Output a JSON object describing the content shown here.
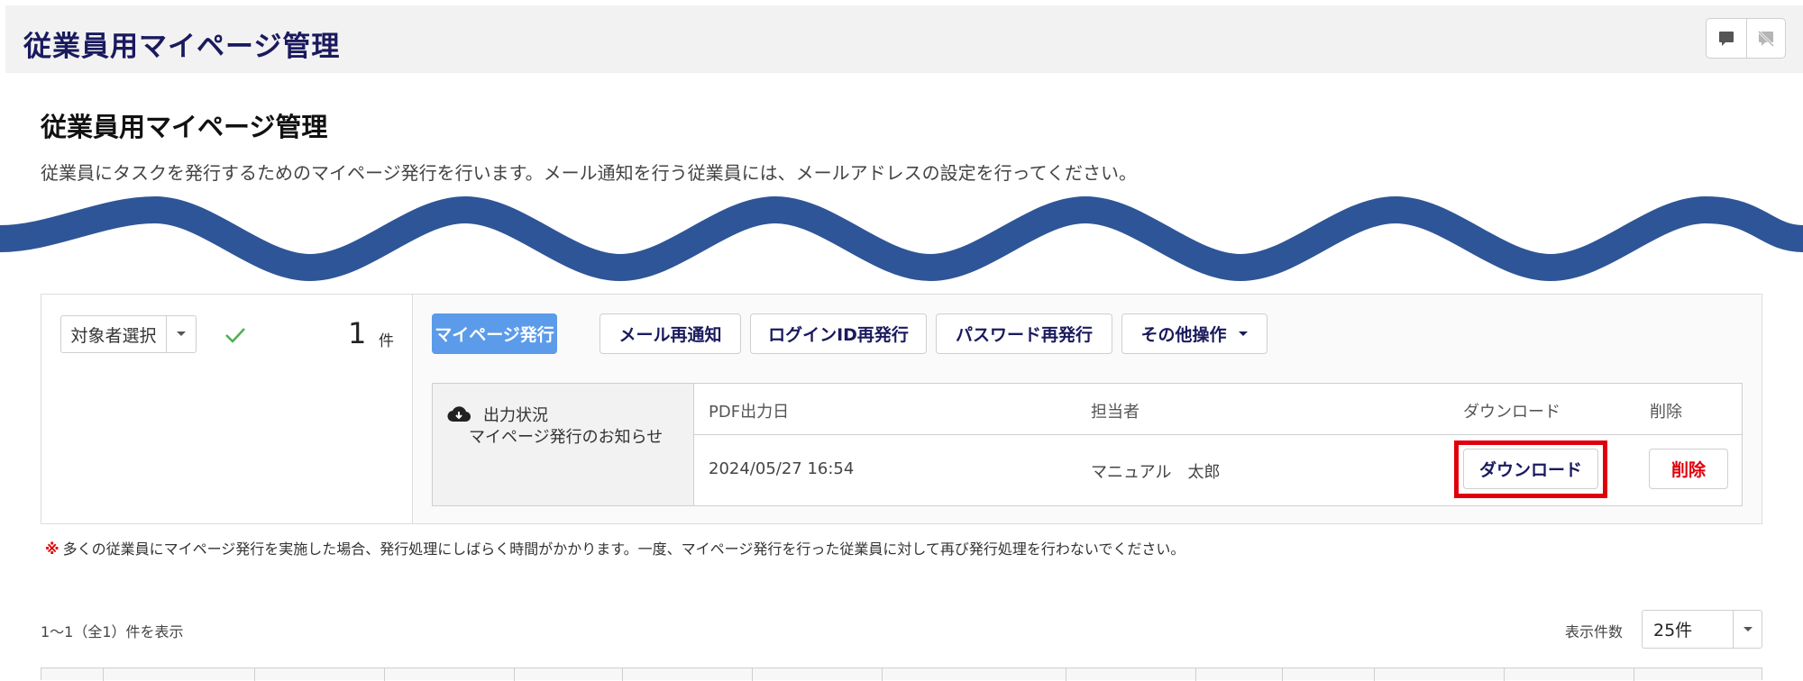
{
  "header": {
    "title": "従業員用マイページ管理",
    "icons": [
      "comment-icon",
      "comment-off-icon"
    ]
  },
  "page": {
    "title": "従業員用マイページ管理",
    "description": "従業員にタスクを発行するためのマイページ発行を行います。メール通知を行う従業員には、メールアドレスの設定を行ってください。"
  },
  "colors": {
    "wave": "#2e5597",
    "primary": "#5b9bea",
    "highlight": "#e0000b",
    "navy_text": "#1a1a5e"
  },
  "selection": {
    "target_label": "対象者選択",
    "count": "1",
    "count_unit": "件"
  },
  "toolbar": {
    "issue": "マイページ発行",
    "resend_mail": "メール再通知",
    "reissue_login": "ログインID再発行",
    "reissue_password": "パスワード再発行",
    "other": "その他操作"
  },
  "output_status": {
    "label": "出力状況",
    "sub_label": "マイページ発行のお知らせ",
    "columns": [
      "PDF出力日",
      "担当者",
      "ダウンロード",
      "削除"
    ],
    "rows": [
      {
        "date": "2024/05/27 16:54",
        "person": "マニュアル　太郎",
        "download": "ダウンロード",
        "delete": "削除"
      }
    ]
  },
  "notice": {
    "mark": "※",
    "text": "多くの従業員にマイページ発行を実施した場合、発行処理にしばらく時間がかかります。一度、マイページ発行を行った従業員に対して再び発行処理を行わないでください。"
  },
  "list": {
    "range": "1～1（全1）件を表示",
    "per_page_label": "表示件数",
    "per_page_value": "25件"
  }
}
